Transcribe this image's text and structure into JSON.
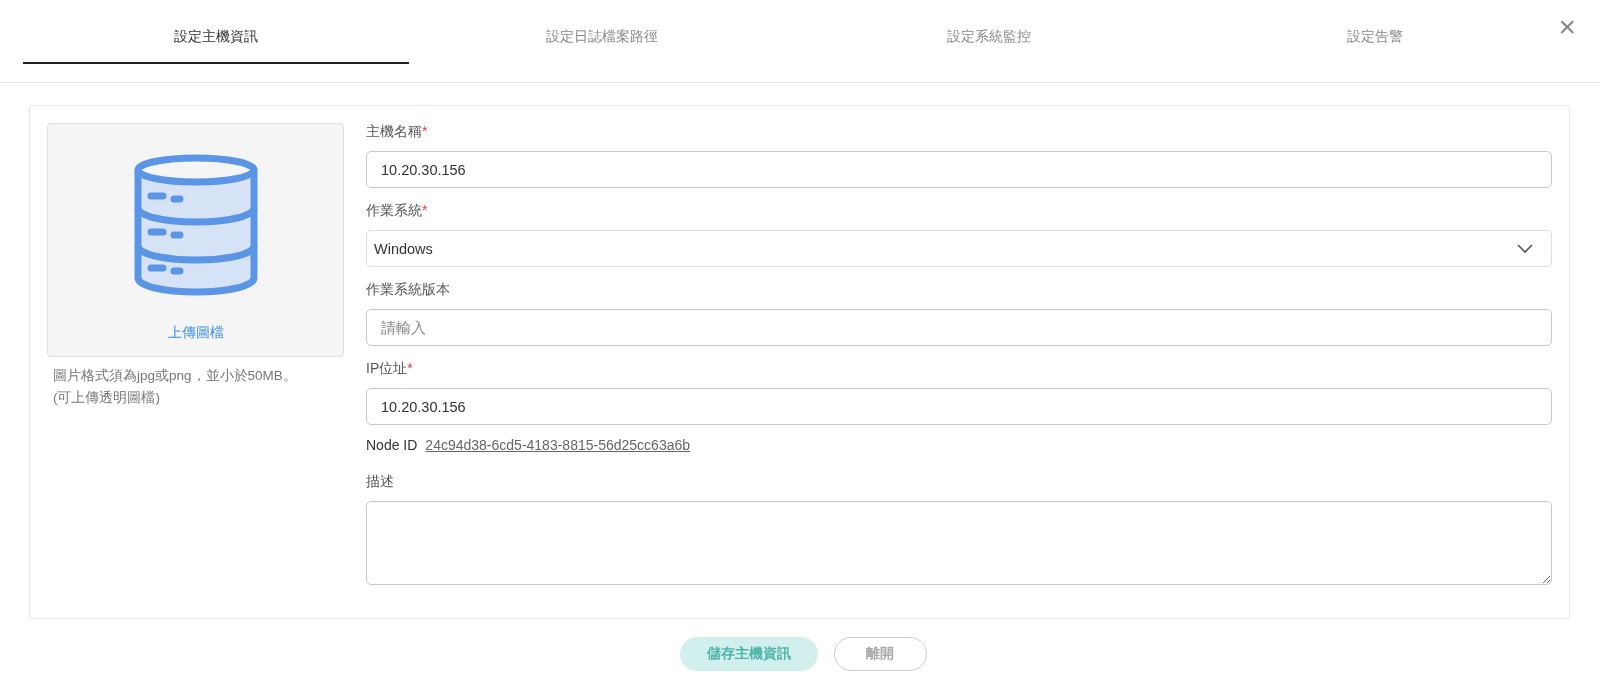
{
  "tabs": [
    {
      "label": "設定主機資訊",
      "selected": true
    },
    {
      "label": "設定日誌檔案路徑",
      "selected": false
    },
    {
      "label": "設定系統監控",
      "selected": false
    },
    {
      "label": "設定告警",
      "selected": false
    }
  ],
  "close_button": {
    "label": "×"
  },
  "required_mark": "*",
  "image_upload": {
    "link": "上傳圖檔",
    "hint_lines": [
      "圖片格式須為jpg或png，並小於50MB。",
      "(可上傳透明圖檔)"
    ]
  },
  "fields": [
    {
      "kind": "text",
      "label": "主機名稱",
      "required": true,
      "value": "10.20.30.156"
    },
    {
      "kind": "select",
      "label": "作業系統",
      "required": true,
      "value": "Windows"
    },
    {
      "kind": "text",
      "label": "作業系統版本",
      "required": false,
      "placeholder": "請輸入"
    },
    {
      "kind": "text",
      "label": "IP位址",
      "required": true,
      "value": "10.20.30.156"
    },
    {
      "kind": "info",
      "label": "Node ID",
      "value": "24c94d38-6cd5-4183-8815-56d25cc63a6b"
    },
    {
      "kind": "textarea",
      "label": "描述",
      "required": false
    }
  ],
  "buttons": [
    {
      "kind": "primary",
      "label": "儲存主機資訊"
    },
    {
      "kind": "secondary",
      "label": "離開"
    }
  ]
}
